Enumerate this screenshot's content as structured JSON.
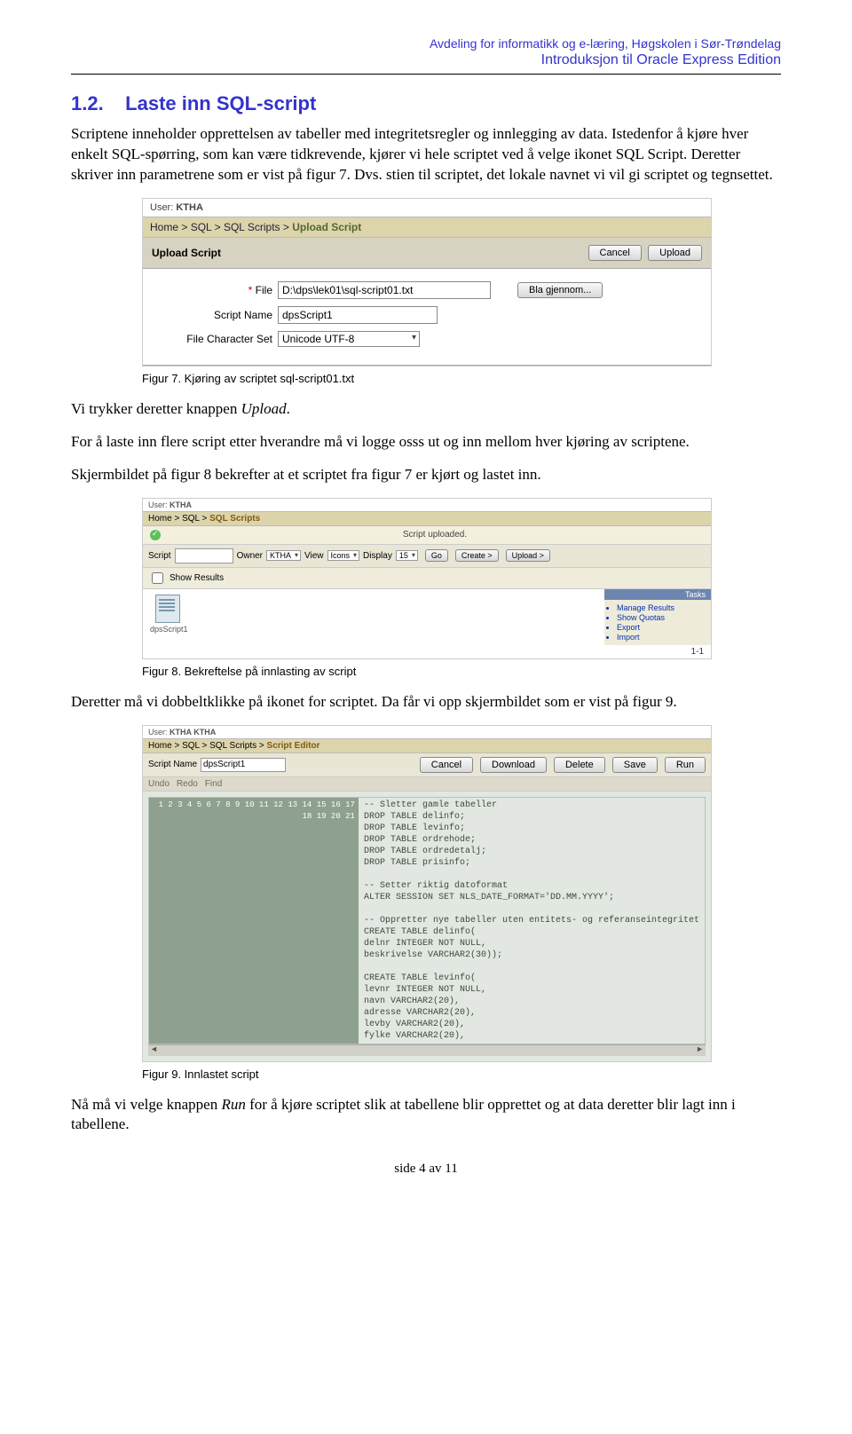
{
  "header": {
    "line1": "Avdeling for informatikk og e-læring, Høgskolen i Sør-Trøndelag",
    "line2": "Introduksjon til Oracle Express Edition"
  },
  "section": {
    "number": "1.2.",
    "title": "Laste inn SQL-script"
  },
  "para1": "Scriptene inneholder opprettelsen av tabeller med integritetsregler og innlegging av data. Istedenfor å kjøre hver enkelt SQL-spørring, som kan være tidkrevende, kjører vi hele scriptet ved å velge ikonet SQL Script. Deretter skriver inn parametrene som er vist på figur 7. Dvs. stien til scriptet, det lokale navnet vi vil gi scriptet og tegnsettet.",
  "fig7": {
    "user_label": "User:",
    "user_value": "KTHA",
    "crumb": [
      "Home",
      "SQL",
      "SQL Scripts",
      "Upload Script"
    ],
    "panel_title": "Upload Script",
    "btn_cancel": "Cancel",
    "btn_upload": "Upload",
    "file_label": "File",
    "file_value": "D:\\dps\\lek01\\sql-script01.txt",
    "browse": "Bla gjennom...",
    "name_label": "Script Name",
    "name_value": "dpsScript1",
    "charset_label": "File Character Set",
    "charset_value": "Unicode UTF-8"
  },
  "caption7": "Figur 7. Kjøring av scriptet sql-script01.txt",
  "para2a": "Vi trykker deretter knappen ",
  "para2b": "Upload",
  "para2c": ".",
  "para3": "For å laste inn flere script etter hverandre må vi logge osss ut og inn mellom hver kjøring av scriptene.",
  "para4": "Skjermbildet på figur 8 bekrefter at et scriptet fra figur 7 er kjørt og lastet inn.",
  "fig8": {
    "user_label": "User:",
    "user_value": "KTHA",
    "crumb": [
      "Home",
      "SQL",
      "SQL Scripts"
    ],
    "msg": "Script uploaded.",
    "script_label": "Script",
    "owner_label": "Owner",
    "owner_value": "KTHA",
    "view_label": "View",
    "view_value": "Icons",
    "display_label": "Display",
    "display_value": "15",
    "go": "Go",
    "create": "Create >",
    "upload": "Upload >",
    "show_results": "Show Results",
    "tasks_title": "Tasks",
    "tasks": [
      "Manage Results",
      "Show Quotas",
      "Export",
      "Import"
    ],
    "icon_label": "dpsScript1",
    "count": "1-1"
  },
  "caption8": "Figur 8. Bekreftelse på innlasting av script",
  "para5": "Deretter må vi dobbeltklikke på ikonet for scriptet. Da får vi opp skjermbildet som er vist på figur 9.",
  "fig9": {
    "user_label": "User:",
    "user_value": "KTHA   KTHA",
    "crumb": [
      "Home",
      "SQL",
      "SQL Scripts",
      "Script Editor"
    ],
    "name_label": "Script Name",
    "name_value": "dpsScript1",
    "btn_cancel": "Cancel",
    "btn_download": "Download",
    "btn_delete": "Delete",
    "btn_save": "Save",
    "btn_run": "Run",
    "undo": "Undo",
    "redo": "Redo",
    "find": "Find",
    "code": [
      "-- Sletter gamle tabeller",
      "DROP TABLE delinfo;",
      "DROP TABLE levinfo;",
      "DROP TABLE ordrehode;",
      "DROP TABLE ordredetalj;",
      "DROP TABLE prisinfo;",
      "",
      "-- Setter riktig datoformat",
      "ALTER SESSION SET NLS_DATE_FORMAT='DD.MM.YYYY';",
      "",
      "-- Oppretter nye tabeller uten entitets- og referanseintegritet",
      "CREATE TABLE delinfo(",
      "delnr INTEGER NOT NULL,",
      "beskrivelse VARCHAR2(30));",
      "",
      "CREATE TABLE levinfo(",
      "levnr INTEGER NOT NULL,",
      "navn VARCHAR2(20),",
      "adresse VARCHAR2(20),",
      "levby VARCHAR2(20),",
      "fylke VARCHAR2(20),"
    ]
  },
  "caption9": "Figur 9. Innlastet script",
  "para6a": "Nå må vi velge knappen ",
  "para6b": "Run",
  "para6c": " for å kjøre scriptet slik at tabellene blir opprettet og at data deretter blir lagt inn i tabellene.",
  "footer": "side 4 av 11"
}
